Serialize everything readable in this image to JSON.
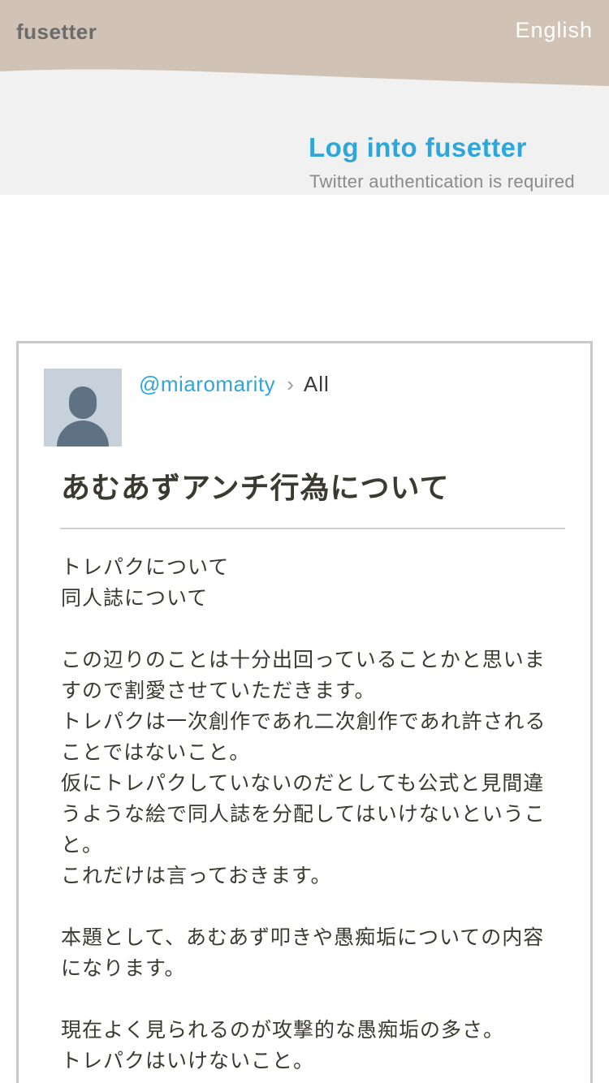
{
  "header": {
    "logo": "fusetter",
    "language": "English",
    "colors": {
      "bar": "#d0c3b5",
      "accent": "#2fa6d9"
    }
  },
  "login": {
    "title": "Log into fusetter",
    "subtitle": "Twitter authentication is required"
  },
  "post": {
    "avatar_icon": "default-user-icon",
    "username": "@miaromarity",
    "separator": "›",
    "scope": "All",
    "title": "あむあずアンチ行為について",
    "paragraphs": [
      [
        "トレパクについて",
        "同人誌について"
      ],
      [
        "この辺りのことは十分出回っていることかと思いますので割愛させていただきます。",
        "トレパクは一次創作であれ二次創作であれ許されることではないこと。",
        "仮にトレパクしていないのだとしても公式と見間違うような絵で同人誌を分配してはいけないということ。",
        "これだけは言っておきます。"
      ],
      [
        "本題として、あむあず叩きや愚痴垢についての内容になります。"
      ],
      [
        "現在よく見られるのが攻撃的な愚痴垢の多さ。",
        "トレパクはいけないこと。"
      ]
    ]
  }
}
